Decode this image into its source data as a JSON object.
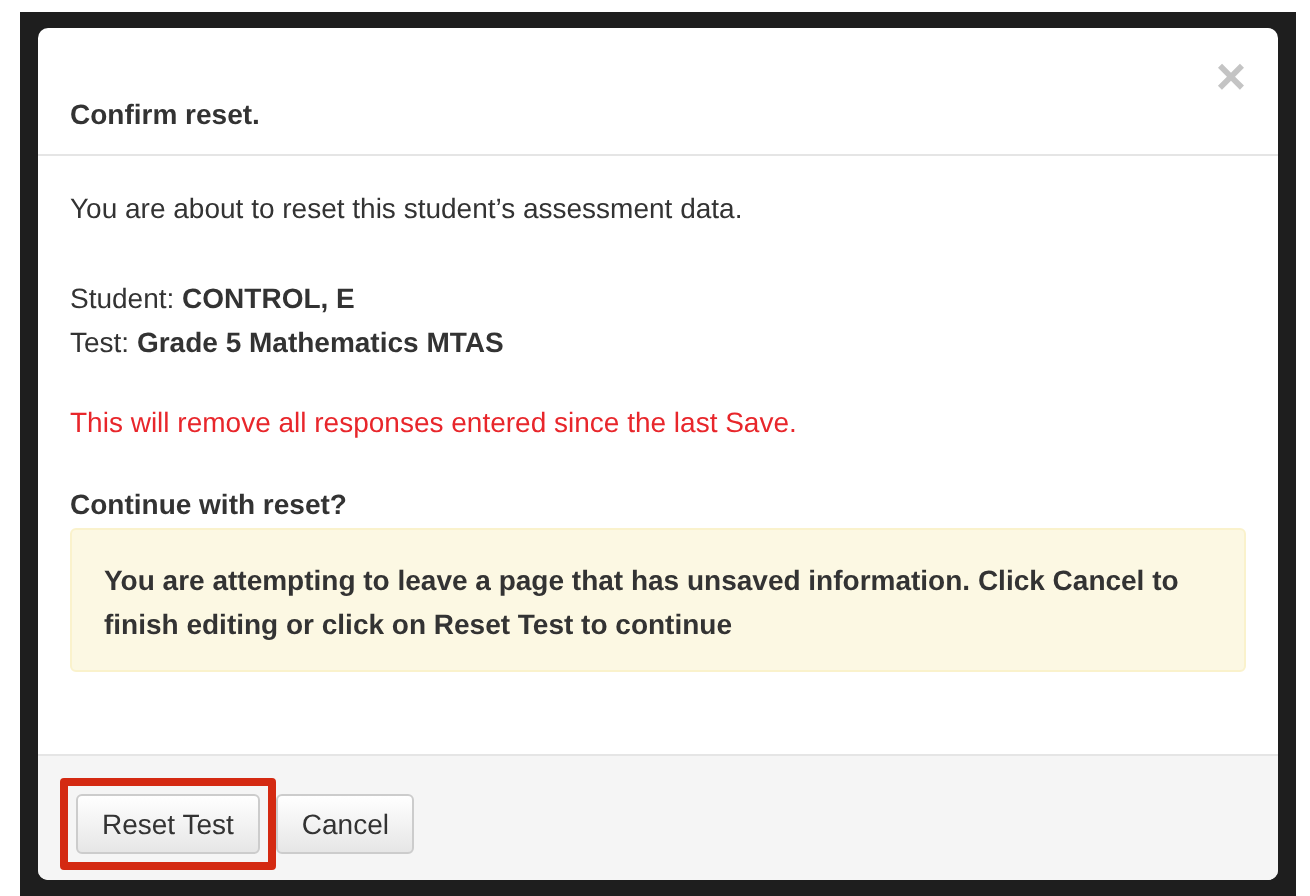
{
  "dialog": {
    "title": "Confirm reset.",
    "close": "×",
    "intro": "You are about to reset this student’s assessment data.",
    "details": [
      {
        "label": "Student:",
        "value": "CONTROL, E"
      },
      {
        "label": "Test:",
        "value": "Grade 5 Mathematics MTAS"
      }
    ],
    "warning": "This will remove all responses entered since the last Save.",
    "question": "Continue with reset?",
    "notice": "You are attempting to leave a page that has unsaved information. Click Cancel to finish editing or click on Reset Test to continue",
    "buttons": [
      {
        "label": "Reset Test",
        "highlighted": true
      },
      {
        "label": "Cancel",
        "highlighted": false
      }
    ]
  }
}
